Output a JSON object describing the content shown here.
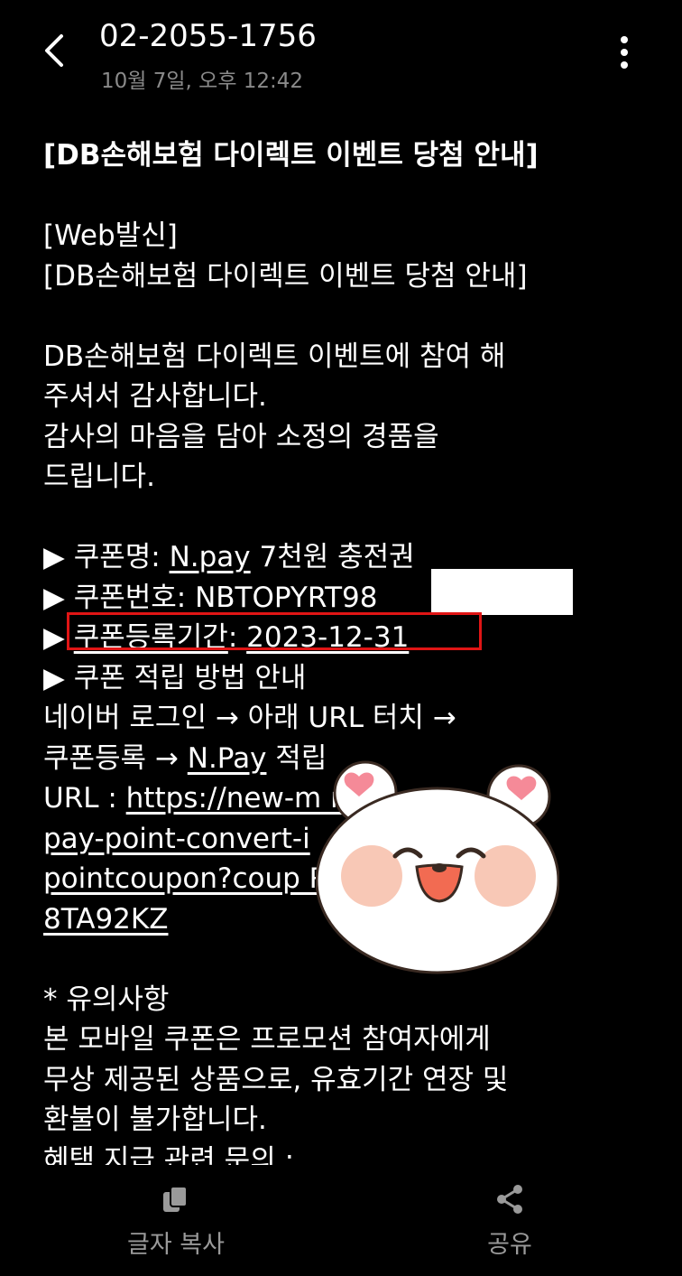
{
  "header": {
    "phone_number": "02-2055-1756",
    "date_time": "10월 7일, 오후 12:42",
    "back_icon": "chevron-left-icon",
    "more_icon": "more-vertical-icon"
  },
  "message": {
    "title": "[DB손해보험 다이렉트 이벤트 당첨 안내]",
    "lines_intro": [
      "[Web발신]",
      "[DB손해보험 다이렉트 이벤트 당첨 안내]"
    ],
    "lines_body": [
      "DB손해보험 다이렉트 이벤트에 참여 해",
      "주셔서 감사합니다.",
      "감사의 마음을 담아 소정의 경품을",
      "드립니다."
    ],
    "coupon_name_prefix": "▶ 쿠폰명: ",
    "coupon_name_link": "N.pay",
    "coupon_name_suffix": " 7천원 충전권",
    "coupon_number": "▶ 쿠폰번호: NBTOPYRT98",
    "coupon_period_prefix": "▶ ",
    "coupon_period_label": "쿠폰등록기간",
    "coupon_period_colon": ": ",
    "coupon_period_date": "2023-12-31",
    "guide_title": "▶ 쿠폰 적립 방법 안내",
    "guide_line1": "네이버 로그인 → 아래 URL 터치 →",
    "guide_line2_prefix": "쿠폰등록 → ",
    "guide_line2_link": "N.Pay",
    "guide_line2_suffix": " 적립",
    "url_prefix": "URL : ",
    "url_lines": [
      "https://new-m                         m/",
      "pay-point-convert-i",
      "pointcoupon?coup                         RT9",
      "8TA92KZ"
    ],
    "notice_title": " * 유의사항",
    "notice_lines": [
      "본 모바일 쿠폰은 프로모션 참여자에게",
      "무상 제공된 상품으로, 유효기간 연장 및",
      "환불이 불가합니다.",
      "혜택 지급 관련 문의 :"
    ]
  },
  "sticker": {
    "name": "bear-sticker"
  },
  "bottom_bar": {
    "copy_label": "글자 복사",
    "share_label": "공유",
    "copy_icon": "copy-icon",
    "share_icon": "share-icon"
  },
  "colors": {
    "background": "#000000",
    "text": "#ffffff",
    "secondary_text": "#8a8a8a",
    "highlight_border": "#e01515"
  }
}
